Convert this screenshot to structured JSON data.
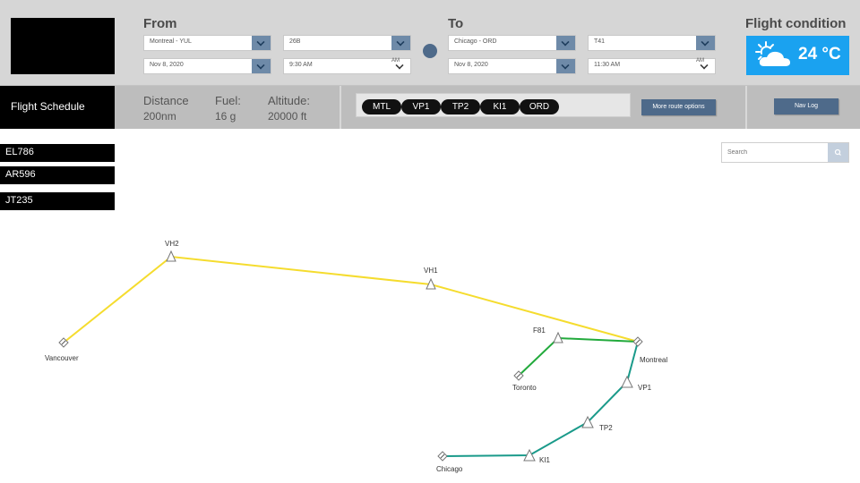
{
  "from": {
    "title": "From",
    "airport": "Montreal - YUL",
    "gate": "26B",
    "date": "Nov 8, 2020",
    "time": "9:30 AM",
    "time_tip": "AM"
  },
  "to": {
    "title": "To",
    "airport": "Chicago - ORD",
    "gate": "T41",
    "date": "Nov 8, 2020",
    "time": "11:30 AM",
    "time_tip": "AM"
  },
  "weather": {
    "title": "Flight condition",
    "temp": "24 °C",
    "icon": "partly-cloudy-icon",
    "bg_color": "#1aa2f0"
  },
  "infobar": {
    "tab_label": "Flight Schedule",
    "distance_label": "Distance",
    "distance_value": "200nm",
    "fuel_label": "Fuel:",
    "fuel_value": "16 g",
    "altitude_label": "Altitude:",
    "altitude_value": "20000 ft",
    "route_points": [
      "MTL",
      "VP1",
      "TP2",
      "KI1",
      "ORD"
    ],
    "more_route_label": "More route options",
    "nav_log_label": "Nav Log",
    "accent_color": "#4e6a8a"
  },
  "flights": [
    "EL786",
    "AR596",
    "JT235"
  ],
  "search": {
    "placeholder": "Search"
  },
  "map": {
    "route_colors": {
      "northern": "#f5dc2e",
      "toronto": "#22aa3c",
      "chicago": "#1a9a8a"
    },
    "airports": [
      "Vancouver",
      "Montreal",
      "Toronto",
      "Chicago"
    ],
    "waypoints": [
      "VH2",
      "VH1",
      "F81",
      "VP1",
      "TP2",
      "KI1"
    ]
  }
}
